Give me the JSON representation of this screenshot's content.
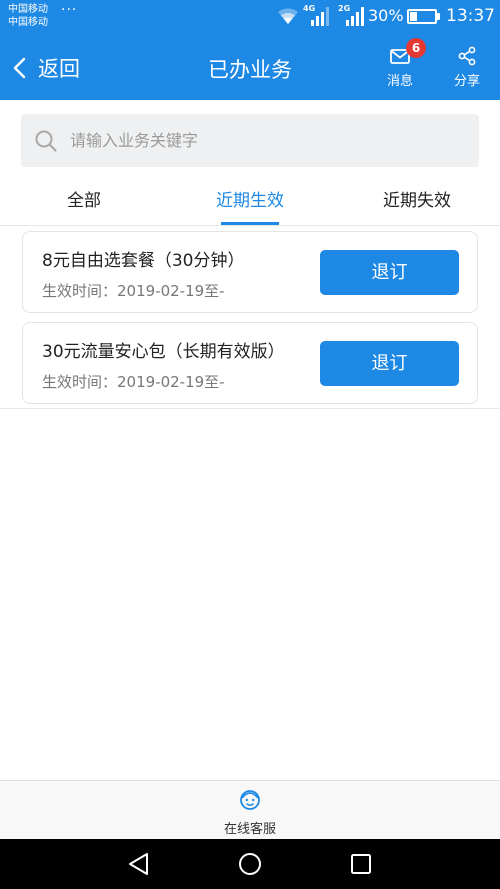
{
  "status_bar": {
    "carrier_1": "中国移动",
    "carrier_2": "中国移动",
    "dots": "···",
    "network_1": "4G",
    "network_2": "2G",
    "battery_percent": "30%",
    "battery_level": 0.3,
    "time": "13:37"
  },
  "header": {
    "back_label": "返回",
    "title": "已办业务",
    "message_label": "消息",
    "message_badge": "6",
    "share_label": "分享"
  },
  "search": {
    "placeholder": "请输入业务关键字",
    "value": ""
  },
  "tabs": {
    "items": [
      {
        "label": "全部"
      },
      {
        "label": "近期生效"
      },
      {
        "label": "近期失效"
      }
    ],
    "active_index": 1
  },
  "services": [
    {
      "name": "8元自由选套餐（30分钟）",
      "effective": "生效时间：2019-02-19至-",
      "button": "退订"
    },
    {
      "name": "30元流量安心包（长期有效版）",
      "effective": "生效时间：2019-02-19至-",
      "button": "退订"
    }
  ],
  "footer": {
    "service_label": "在线客服"
  },
  "colors": {
    "primary": "#1e88e5",
    "badge": "#e53935",
    "nav_bg": "#000000"
  },
  "icons": {
    "back": "chevron-left-icon",
    "message": "envelope-icon",
    "share": "share-icon",
    "search": "search-icon",
    "service": "customer-service-icon",
    "nav_back": "triangle-back-icon",
    "nav_home": "circle-home-icon",
    "nav_recent": "square-recent-icon"
  }
}
